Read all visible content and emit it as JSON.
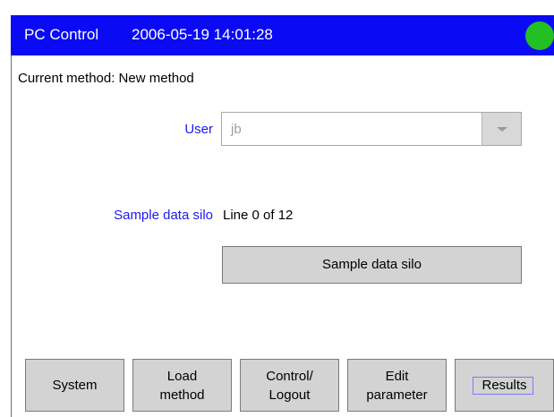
{
  "header": {
    "app_title": "PC Control",
    "datetime": "2006-05-19 14:01:28",
    "status_color": "#22c022"
  },
  "method": {
    "current_text": "Current method: New method"
  },
  "form": {
    "user_label": "User",
    "user_value": "jb",
    "silo_label": "Sample data silo",
    "silo_value": "Line 0 of 12",
    "silo_button_label": "Sample data silo"
  },
  "footer": {
    "buttons": [
      {
        "label": "System"
      },
      {
        "label": "Load\nmethod"
      },
      {
        "label": "Control/\nLogout"
      },
      {
        "label": "Edit\nparameter"
      },
      {
        "label": "Results"
      }
    ]
  },
  "colors": {
    "title_bar": "#0a0af5",
    "label_accent": "#1a1aee",
    "button_face": "#d3d3d3"
  }
}
